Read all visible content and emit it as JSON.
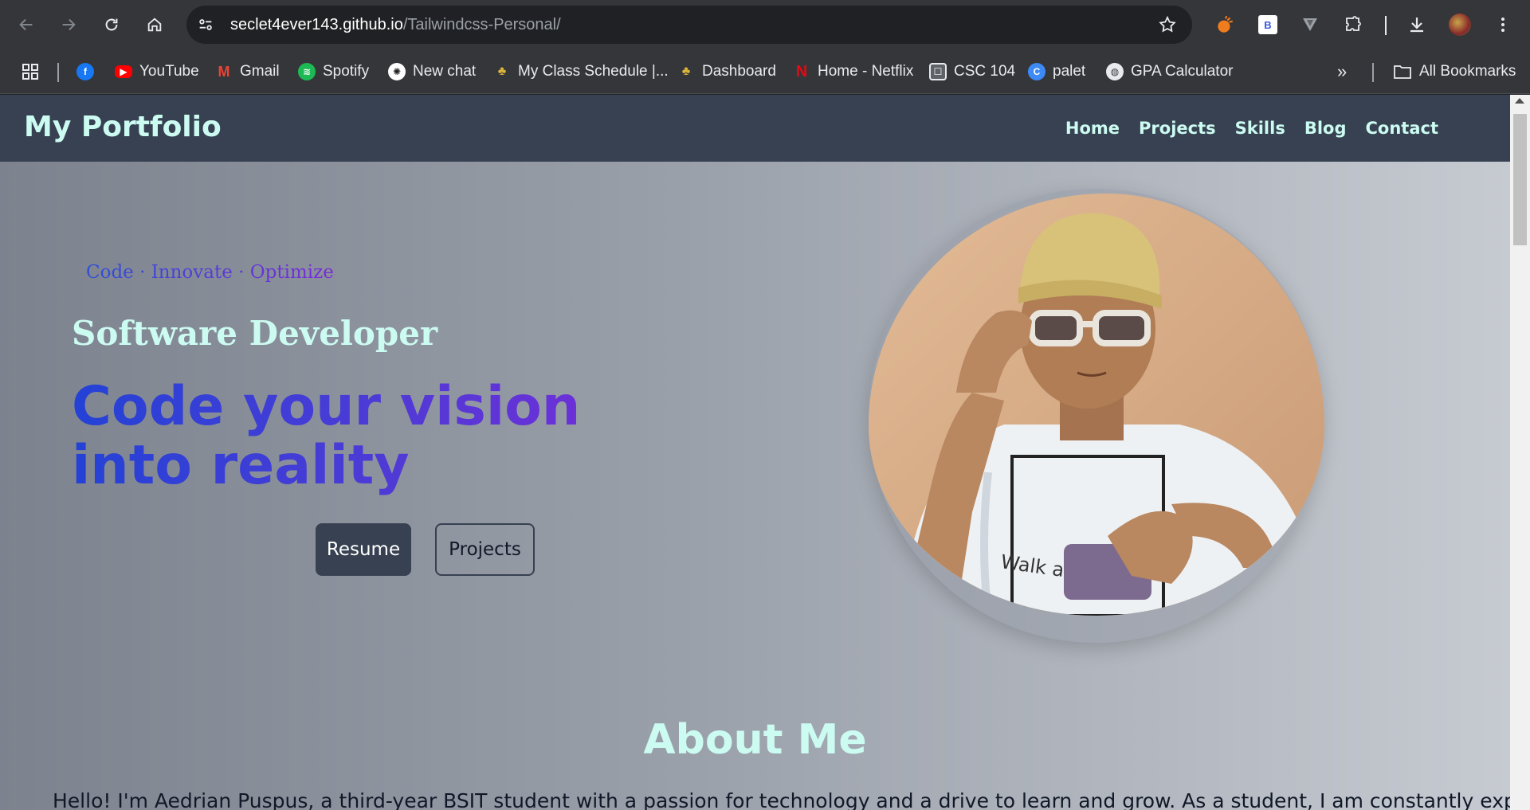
{
  "browser": {
    "url_host": "seclet4ever143.github.io",
    "url_path": "/Tailwindcss-Personal/",
    "bookmarks": [
      {
        "label": "",
        "icon": "facebook-icon"
      },
      {
        "label": "YouTube",
        "icon": "youtube-icon"
      },
      {
        "label": "Gmail",
        "icon": "gmail-icon"
      },
      {
        "label": "Spotify",
        "icon": "spotify-icon"
      },
      {
        "label": "New chat",
        "icon": "chatgpt-icon"
      },
      {
        "label": "My Class Schedule |...",
        "icon": "school-icon"
      },
      {
        "label": "Dashboard",
        "icon": "school-icon"
      },
      {
        "label": "Home - Netflix",
        "icon": "netflix-icon"
      },
      {
        "label": "CSC 104",
        "icon": "classroom-icon"
      },
      {
        "label": "palet",
        "icon": "canva-icon"
      },
      {
        "label": "GPA Calculator",
        "icon": "globe-icon"
      }
    ],
    "all_bookmarks_label": "All Bookmarks"
  },
  "site": {
    "brand": "My Portfolio",
    "nav": [
      "Home",
      "Projects",
      "Skills",
      "Blog",
      "Contact"
    ],
    "hero": {
      "tagline": "Code · Innovate · Optimize",
      "role": "Software Developer",
      "headline": "Code your vision into reality",
      "resume_button": "Resume",
      "projects_button": "Projects"
    },
    "about": {
      "title": "About Me",
      "text": "Hello! I'm Aedrian Puspus, a third-year BSIT student with a passion for technology and a drive to learn and grow. As a student, I am constantly exploring new"
    }
  },
  "colors": {
    "nav_bg": "#374151",
    "accent_text": "#ccfbf1",
    "gradient_start": "#2442d6",
    "gradient_end": "#7a2bd9"
  }
}
